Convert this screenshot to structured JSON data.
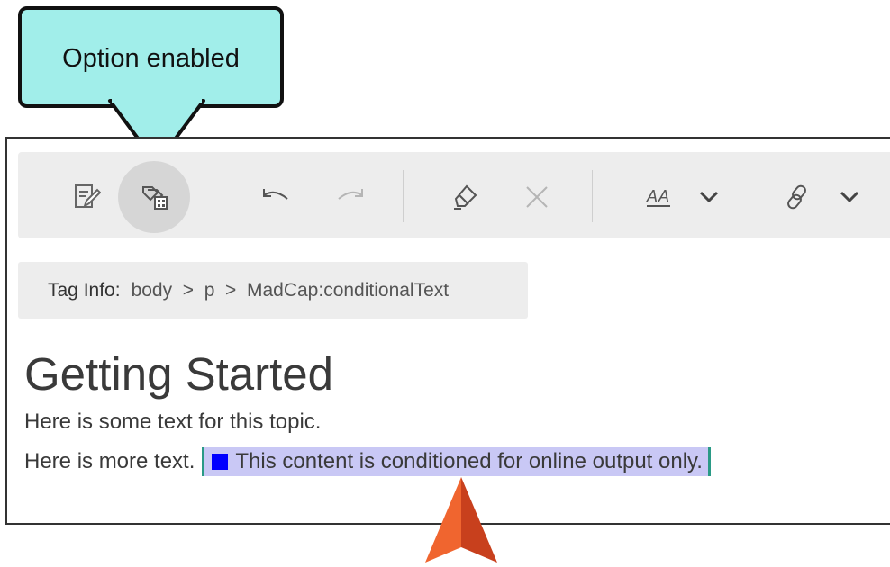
{
  "callout": {
    "text": "Option enabled",
    "color": "#a1eeea"
  },
  "toolbar": {
    "buttons": [
      {
        "name": "edit-icon"
      },
      {
        "name": "show-tags-icon",
        "active": true
      },
      {
        "name": "undo-icon"
      },
      {
        "name": "redo-icon"
      },
      {
        "name": "highlight-icon"
      },
      {
        "name": "clear-icon"
      },
      {
        "name": "text-format-icon",
        "label": "AA"
      },
      {
        "name": "link-icon"
      }
    ]
  },
  "tag_info": {
    "label": "Tag Info:",
    "path": "body  >  p  >  MadCap:conditionalText"
  },
  "content": {
    "heading": "Getting Started",
    "para1": "Here is some text for this topic.",
    "para2_prefix": "Here is more text.",
    "conditional_text": "This content is conditioned for online output only.",
    "condition_color": "#0000ff",
    "highlight_color": "#c9c8f5"
  },
  "pointer": {
    "name": "arrow-pointer-icon",
    "color": "#e8542a"
  }
}
